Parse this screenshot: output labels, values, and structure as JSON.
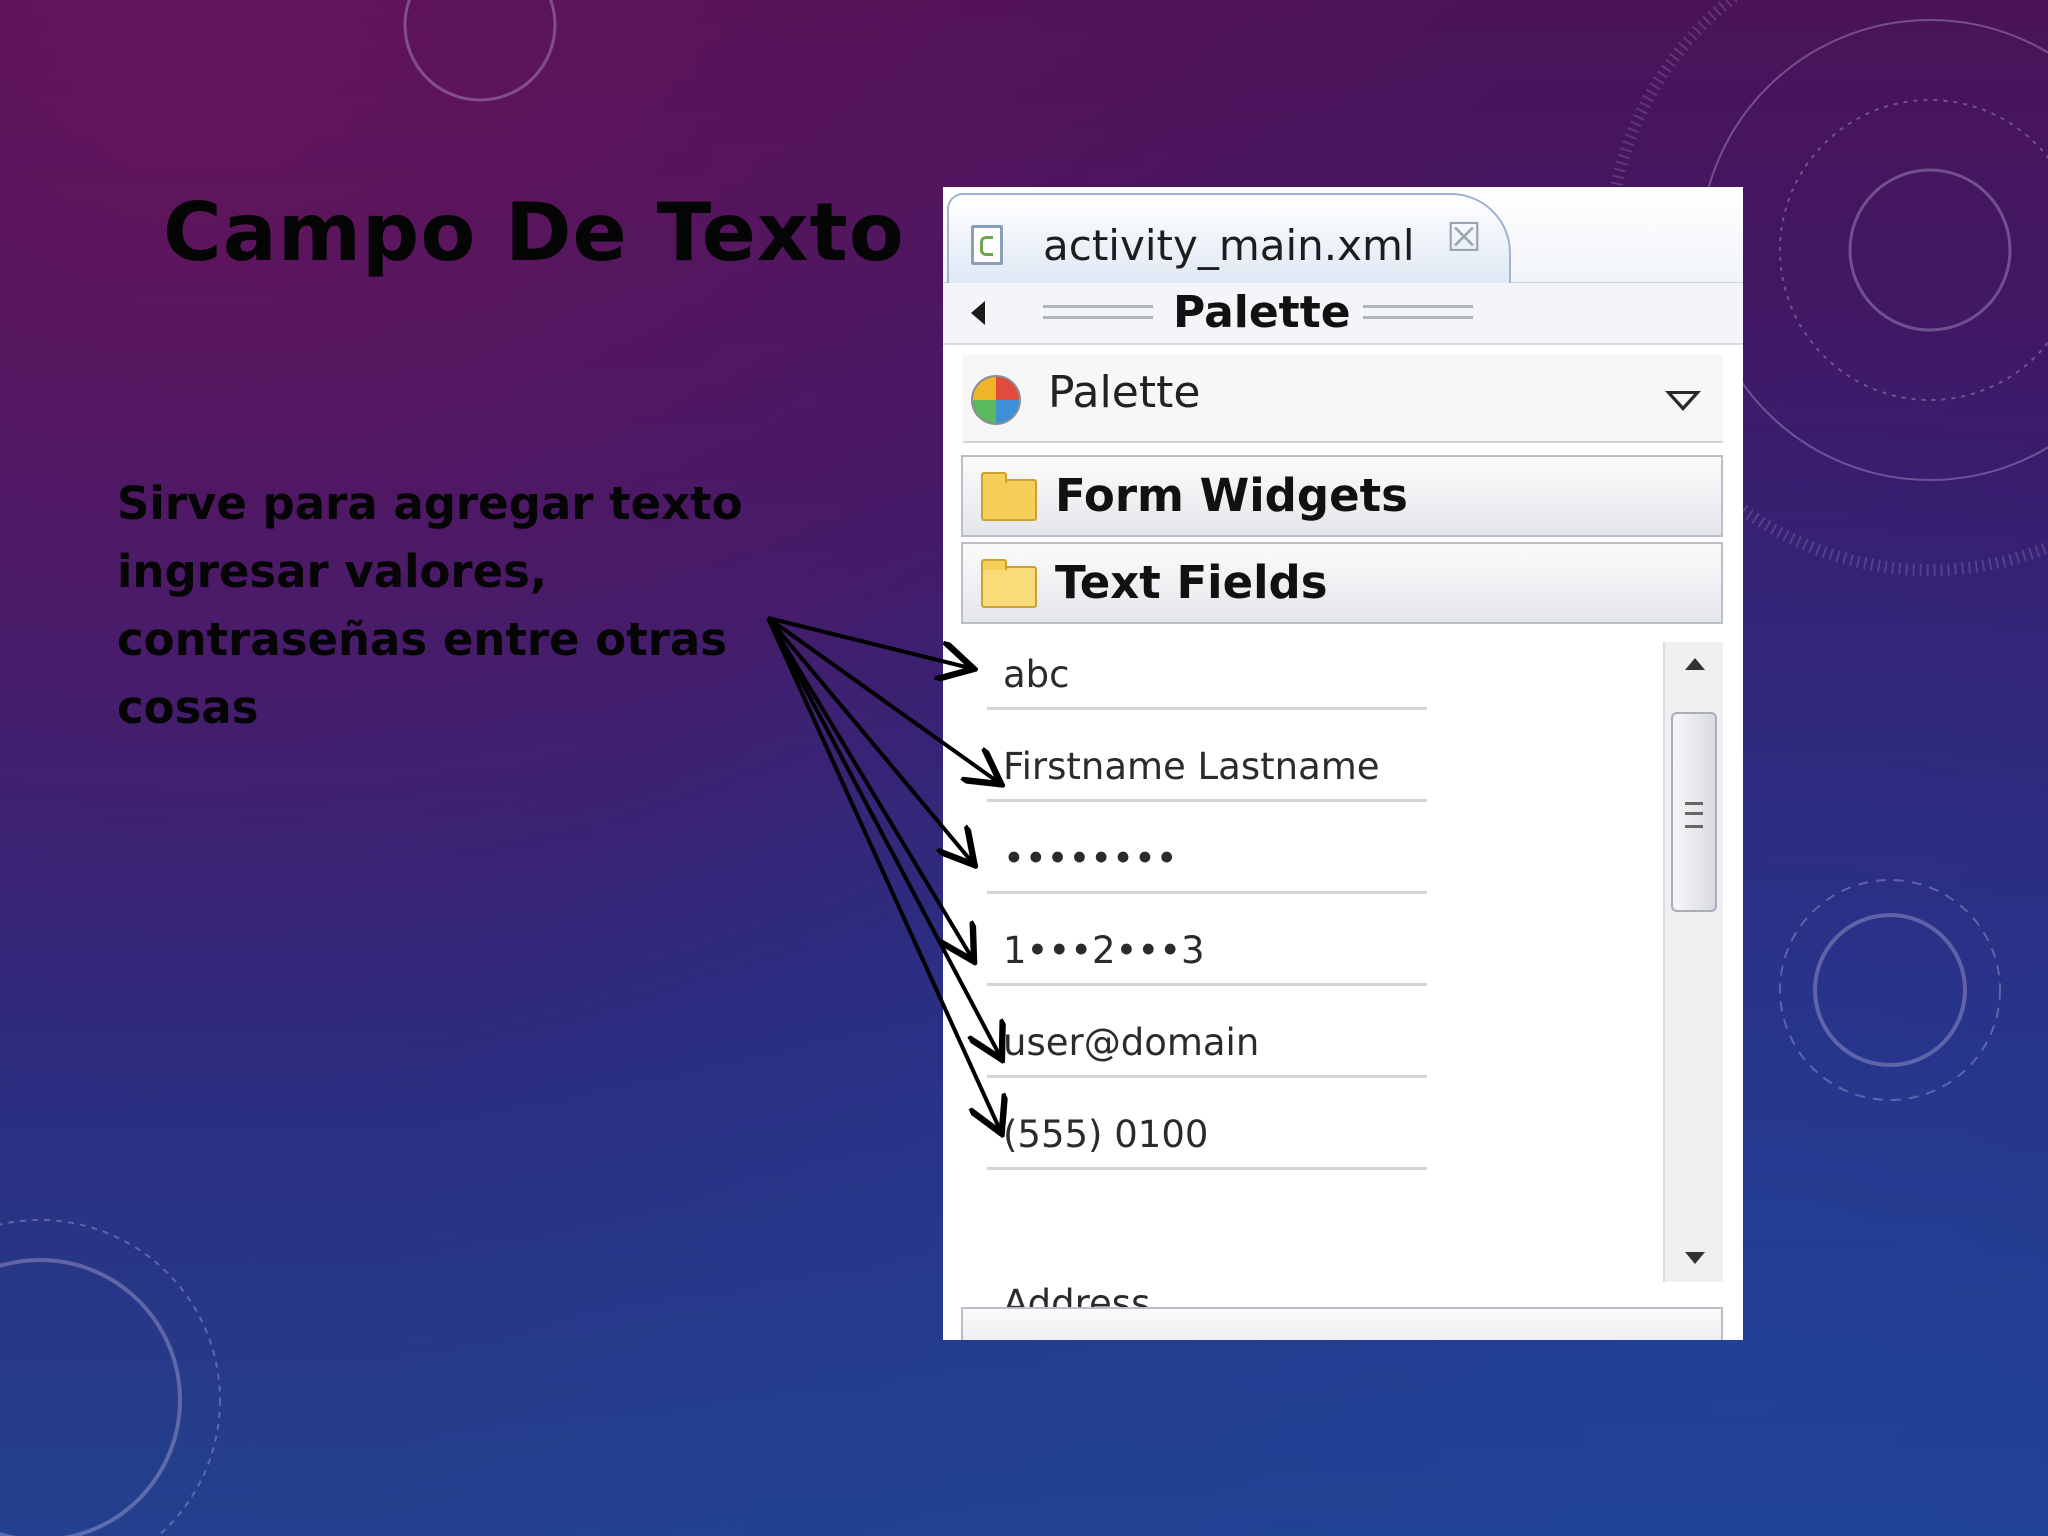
{
  "slide": {
    "title": "Campo De Texto",
    "body": "Sirve para agregar texto ingresar valores, contraseñas entre otras cosas"
  },
  "editor": {
    "tab_label": "activity_main.xml",
    "close_glyph": "☒",
    "palette_header": "Palette",
    "palette_selector": "Palette",
    "categories": [
      {
        "label": "Form Widgets",
        "state": "collapsed"
      },
      {
        "label": "Text Fields",
        "state": "expanded"
      }
    ],
    "text_fields": [
      {
        "label": "abc"
      },
      {
        "label": "Firstname Lastname"
      },
      {
        "label": "••••••••"
      },
      {
        "label": "1•••2•••3"
      },
      {
        "label": "user@domain"
      },
      {
        "label": "(555) 0100"
      }
    ],
    "cut_off_label": "Address"
  },
  "icons": {
    "tab": "xml-file-icon",
    "close": "close-icon",
    "back": "back-arrow-icon",
    "palette": "palette-icon",
    "dropdown": "dropdown-triangle-icon",
    "folder": "folder-icon",
    "scroll_up": "scroll-up-icon",
    "scroll_down": "scroll-down-icon"
  },
  "colors": {
    "background_top": "#4a1358",
    "background_bottom": "#23418e",
    "text": "#050505",
    "folder": "#f6cf5a"
  }
}
